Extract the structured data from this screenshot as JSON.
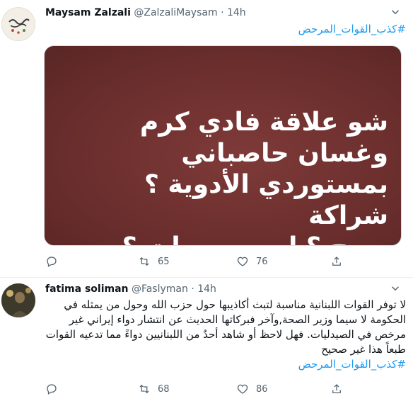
{
  "tweets": [
    {
      "name": "Maysam Zalzali",
      "handle": "@ZalzaliMaysam",
      "separator": "·",
      "time": "14h",
      "text": "",
      "hashtag": "#كذب_القوات_المرحض",
      "image_lines": [
        "شو علاقة فادي كرم",
        "وغسان حاصباني",
        "بمستوردي الأدوية ؟ شراكة",
        "وربح ؟ او سمسرات ؟"
      ],
      "stats": {
        "replies": "",
        "retweets": "65",
        "likes": "76"
      }
    },
    {
      "name": "fatima soliman",
      "handle": "@Faslyman",
      "separator": "·",
      "time": "14h",
      "text": "لا توفر القوات اللبنانية مناسبة لتبث أكاذيبها حول حزب الله وحول من يمثله في الحكومة لا سيما وزير الصحة,وآخر فبركاتها الحديث عن انتشار دواء إيراني غير مرخص في الصيدليات. فهل لاحظ أو شاهد أحدٌ من اللبنانيين دواءً مما تدعيه القوات طبعاً هذا غير صحيح",
      "hashtag": "#كذب_القوات_المرحض",
      "stats": {
        "replies": "",
        "retweets": "68",
        "likes": "86"
      }
    }
  ],
  "colors": {
    "accent": "#1d9bf0",
    "muted": "#536471",
    "text": "#0f1419",
    "image_bg": "#6a2e2d"
  }
}
